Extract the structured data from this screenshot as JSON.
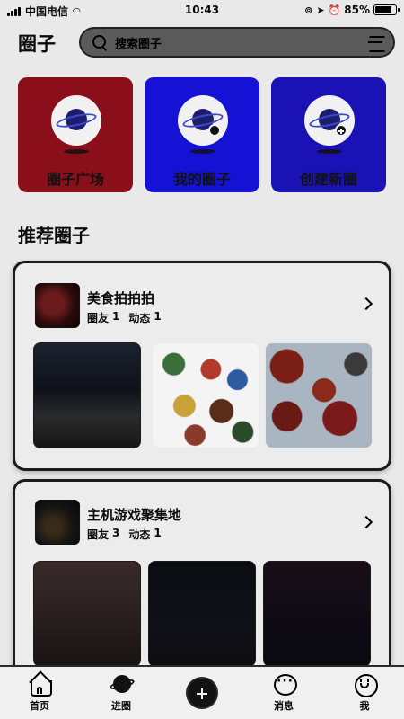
{
  "status_bar": {
    "carrier": "中国电信",
    "time": "10:43",
    "battery_percent": "85%",
    "battery_level": 0.85
  },
  "header": {
    "title": "圈子",
    "search_placeholder": "搜索圈子"
  },
  "feature_cards": [
    {
      "label": "圈子广场",
      "color": "#8b0f1a",
      "badge": "none"
    },
    {
      "label": "我的圈子",
      "color": "#1512d6",
      "badge": "person"
    },
    {
      "label": "创建新圈",
      "color": "#1b12b6",
      "badge": "plus"
    }
  ],
  "section_title": "推荐圈子",
  "circles": [
    {
      "name": "美食拍拍拍",
      "members_label": "圈友",
      "members": "1",
      "posts_label": "动态",
      "posts": "1"
    },
    {
      "name": "主机游戏聚集地",
      "members_label": "圈友",
      "members": "3",
      "posts_label": "动态",
      "posts": "1"
    }
  ],
  "bottom_nav": {
    "home": "首页",
    "circles": "进圈",
    "messages": "消息",
    "me": "我"
  },
  "colors": {
    "background": "#e9e9e9",
    "card_red": "#8b0f1a",
    "card_blue": "#1512d6",
    "card_indigo": "#1b12b6"
  }
}
